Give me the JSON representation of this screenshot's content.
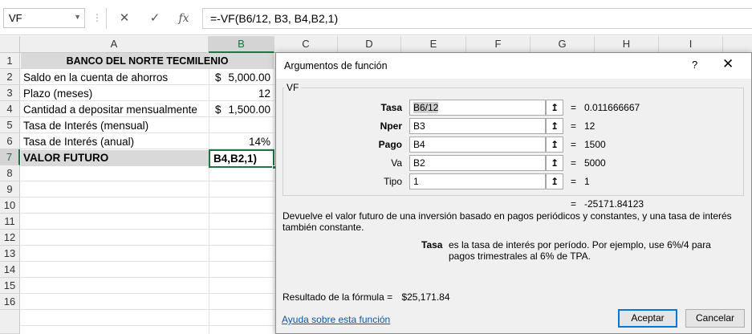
{
  "formula_bar": {
    "name_box": "VF",
    "name_box_dropdown_icon": "chevron-down-icon",
    "cancel_icon": "x-icon",
    "enter_icon": "check-icon",
    "fx_label": "fx",
    "formula": "=-VF(B6/12, B3, B4,B2,1)"
  },
  "grid": {
    "columns": [
      "A",
      "B",
      "C",
      "D",
      "E",
      "F",
      "G",
      "H",
      "I"
    ],
    "rows": [
      "1",
      "2",
      "3",
      "4",
      "5",
      "6",
      "7",
      "8",
      "9",
      "10",
      "11",
      "12",
      "13",
      "14",
      "15",
      "16"
    ],
    "cells": {
      "A1": "BANCO DEL NORTE TECMILENIO",
      "A2": "Saldo en la cuenta de ahorros",
      "B2_currency": "$",
      "B2_value": "5,000.00",
      "A3": "Plazo (meses)",
      "B3": "12",
      "A4": "Cantidad a depositar mensualmente",
      "B4_currency": "$",
      "B4_value": "1,500.00",
      "A5": "Tasa de Interés (mensual)",
      "A6": "Tasa de Interés (anual)",
      "B6": "14%",
      "A7": "VALOR FUTURO",
      "B7": "B4,B2,1)"
    }
  },
  "dialog": {
    "title": "Argumentos de función",
    "help": "?",
    "close": "✕",
    "function_name": "VF",
    "args": [
      {
        "label": "Tasa",
        "value": "B6/12",
        "result": "0.011666667"
      },
      {
        "label": "Nper",
        "value": "B3",
        "result": "12"
      },
      {
        "label": "Pago",
        "value": "B4",
        "result": "1500"
      },
      {
        "label": "Va",
        "value": "B2",
        "result": "5000"
      },
      {
        "label": "Tipo",
        "value": "1",
        "result": "1"
      }
    ],
    "equals": "=",
    "total_result": "-25171.84123",
    "description": "Devuelve el valor futuro de una inversión basado en pagos periódicos y constantes, y una tasa de interés también constante.",
    "param_name": "Tasa",
    "param_description": "es la tasa de interés por período. Por ejemplo, use 6%/4 para pagos trimestrales al 6% de TPA.",
    "formula_result_label": "Resultado de la fórmula =",
    "formula_result_value": "$25,171.84",
    "help_link": "Ayuda sobre esta función",
    "ok_button": "Aceptar",
    "cancel_button": "Cancelar"
  }
}
